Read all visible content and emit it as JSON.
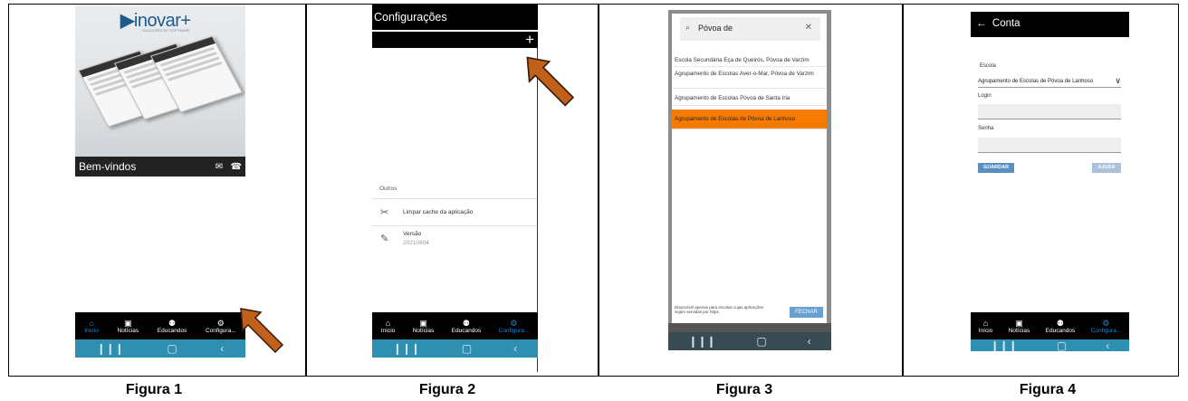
{
  "captions": [
    "Figura 1",
    "Figura 2",
    "Figura 3",
    "Figura 4"
  ],
  "colors": {
    "accent": "#1e88e5",
    "selected": "#f57c00",
    "system_bar": "#2e8fb0",
    "arrow": "#c0601a"
  },
  "nav": {
    "items": [
      {
        "label": "Início",
        "icon": "home-icon"
      },
      {
        "label": "Notícias",
        "icon": "news-icon"
      },
      {
        "label": "Educandos",
        "icon": "people-icon"
      },
      {
        "label": "Configura...",
        "icon": "gear-icon"
      }
    ]
  },
  "fig1": {
    "logo": "inovar+",
    "logo_tagline": "SOLUÇÕES DE SOFTWARE",
    "welcome": "Bem-vindos",
    "active_tab": "Início"
  },
  "fig2": {
    "title": "Configurações",
    "add_label": "+",
    "section": "Outros",
    "clear_cache": "Limpar cache da aplicação",
    "version_label": "Versão",
    "version_value": "20210804",
    "active_tab": "Configura..."
  },
  "fig3": {
    "search_value": "Póvoa de",
    "results": [
      "Escola Secundária Eça de Queirós, Póvoa de Varzim",
      "Agrupamento de Escolas Aver-o-Mar, Póvoa de Varzim",
      "Agrupamento de Escolas Póvoa de Santa Iria",
      "Agrupamento de Escolas de Póvoa de Lanhoso"
    ],
    "selected_index": 3,
    "footer_note": "Disponível apenas para escolas cujas aplicações sejam servidas por https.",
    "close_label": "FECHAR"
  },
  "fig4": {
    "title": "Conta",
    "school_label": "Escola",
    "school_value": "Agrupamento de Escolas de Póvoa de Lanhoso",
    "login_label": "Login",
    "password_label": "Senha",
    "save_label": "GUARDAR",
    "help_label": "AJUDA",
    "active_tab": "Configura..."
  }
}
